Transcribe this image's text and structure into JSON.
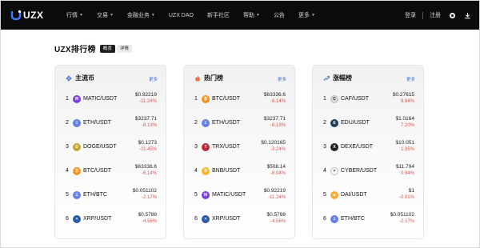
{
  "header": {
    "logo_text": "UZX",
    "nav": [
      {
        "label": "行情",
        "has_dropdown": true
      },
      {
        "label": "交易",
        "has_dropdown": true
      },
      {
        "label": "金融业务",
        "has_dropdown": true
      },
      {
        "label": "UZX DAO",
        "has_dropdown": false
      },
      {
        "label": "新手社区",
        "has_dropdown": false
      },
      {
        "label": "帮助",
        "has_dropdown": true
      },
      {
        "label": "公告",
        "has_dropdown": false
      },
      {
        "label": "更多",
        "has_dropdown": true
      }
    ],
    "login": "登录",
    "register": "注册"
  },
  "page": {
    "title": "UZX排行榜",
    "tabs": [
      {
        "label": "概览",
        "active": true
      },
      {
        "label": "详情",
        "active": false
      }
    ]
  },
  "cards": [
    {
      "title": "主流币",
      "icon": "diamond-icon",
      "more": "更多",
      "rows": [
        {
          "rank": "1",
          "pair": "MATIC/USDT",
          "price": "$0.92219",
          "change": "-11.24%",
          "coin_color": "#7b3fe4",
          "coin_glyph": "M"
        },
        {
          "rank": "2",
          "pair": "ETH/USDT",
          "price": "$3237.71",
          "change": "-8.13%",
          "coin_color": "#627eea",
          "coin_glyph": "Ξ"
        },
        {
          "rank": "3",
          "pair": "DOGE/USDT",
          "price": "$0.1273",
          "change": "-11.45%",
          "coin_color": "#c2a633",
          "coin_glyph": "D"
        },
        {
          "rank": "4",
          "pair": "BTC/USDT",
          "price": "$63336.6",
          "change": "-6.14%",
          "coin_color": "#f7931a",
          "coin_glyph": "₿"
        },
        {
          "rank": "5",
          "pair": "ETH/BTC",
          "price": "$0.051102",
          "change": "-2.17%",
          "coin_color": "#627eea",
          "coin_glyph": "Ξ"
        },
        {
          "rank": "6",
          "pair": "XRP/USDT",
          "price": "$0.5788",
          "change": "-4.56%",
          "coin_color": "#2b5aa6",
          "coin_glyph": "✕"
        }
      ]
    },
    {
      "title": "热门榜",
      "icon": "flame-icon",
      "more": "更多",
      "rows": [
        {
          "rank": "1",
          "pair": "BTC/USDT",
          "price": "$63336.6",
          "change": "-6.14%",
          "coin_color": "#f7931a",
          "coin_glyph": "₿"
        },
        {
          "rank": "2",
          "pair": "ETH/USDT",
          "price": "$3237.71",
          "change": "-8.13%",
          "coin_color": "#627eea",
          "coin_glyph": "Ξ"
        },
        {
          "rank": "3",
          "pair": "TRX/USDT",
          "price": "$0.120165",
          "change": "-3.24%",
          "coin_color": "#c0283a",
          "coin_glyph": "T"
        },
        {
          "rank": "4",
          "pair": "BNB/USDT",
          "price": "$508.14",
          "change": "-8.04%",
          "coin_color": "#f3ba2f",
          "coin_glyph": "B"
        },
        {
          "rank": "5",
          "pair": "MATIC/USDT",
          "price": "$0.92219",
          "change": "-11.24%",
          "coin_color": "#7b3fe4",
          "coin_glyph": "M"
        },
        {
          "rank": "6",
          "pair": "XRP/USDT",
          "price": "$0.5788",
          "change": "-4.56%",
          "coin_color": "#2b5aa6",
          "coin_glyph": "✕"
        }
      ]
    },
    {
      "title": "涨幅榜",
      "icon": "trend-up-icon",
      "more": "更多",
      "rows": [
        {
          "rank": "1",
          "pair": "CAF/USDT",
          "price": "$0.27615",
          "change": "9.84%",
          "coin_color": "#d8d8d8",
          "coin_glyph": "C"
        },
        {
          "rank": "2",
          "pair": "EDU/USDT",
          "price": "$1.0164",
          "change": "7.20%",
          "coin_color": "#1f3b5a",
          "coin_glyph": "E"
        },
        {
          "rank": "3",
          "pair": "DEXE/USDT",
          "price": "$10.051",
          "change": "1.35%",
          "coin_color": "#222222",
          "coin_glyph": "X"
        },
        {
          "rank": "4",
          "pair": "CYBER/USDT",
          "price": "$11.794",
          "change": "0.94%",
          "coin_color": "#ffffff",
          "coin_glyph": "✕"
        },
        {
          "rank": "5",
          "pair": "DAI/USDT",
          "price": "$1",
          "change": "-0.01%",
          "coin_color": "#f5ac37",
          "coin_glyph": "◈"
        },
        {
          "rank": "6",
          "pair": "ETH/BTC",
          "price": "$0.051102",
          "change": "-2.17%",
          "coin_color": "#627eea",
          "coin_glyph": "Ξ"
        }
      ]
    }
  ]
}
